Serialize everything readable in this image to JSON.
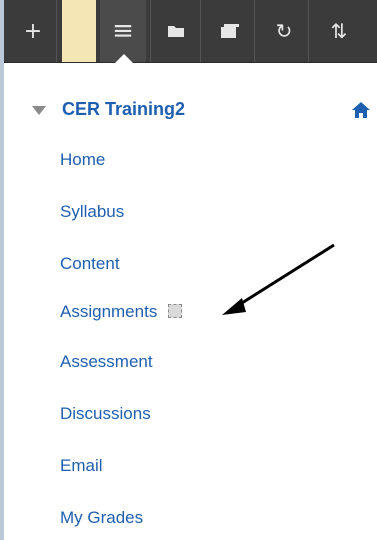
{
  "toolbar": {
    "buttons": [
      {
        "id": "add",
        "icon": "plus-icon",
        "glyph": "+"
      },
      {
        "id": "menu-list",
        "icon": "list-icon",
        "glyph": "≡"
      },
      {
        "id": "folder",
        "icon": "folder-icon",
        "glyph": "▭"
      },
      {
        "id": "window",
        "icon": "window-icon",
        "glyph": "▭"
      },
      {
        "id": "refresh",
        "icon": "refresh-icon",
        "glyph": "↻"
      },
      {
        "id": "sort",
        "icon": "sort-icon",
        "glyph": "⇅"
      }
    ]
  },
  "course": {
    "title": "CER Training2"
  },
  "menu": {
    "items": [
      {
        "label": "Home"
      },
      {
        "label": "Syllabus"
      },
      {
        "label": "Content"
      },
      {
        "label": "Assignments"
      },
      {
        "label": "Assessment"
      },
      {
        "label": "Discussions"
      },
      {
        "label": "Email"
      },
      {
        "label": "My Grades"
      }
    ]
  },
  "colors": {
    "accent_blue": "#1f5fb0",
    "toolbar_bg": "#3b3b3b"
  }
}
